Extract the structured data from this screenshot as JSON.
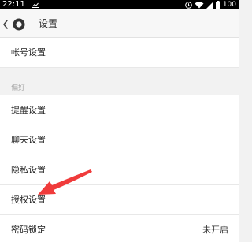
{
  "status_bar": {
    "time": "22:11",
    "battery": "100",
    "icons": [
      "notification-icon",
      "clock-icon",
      "wifi-icon",
      "signal-icon",
      "battery-icon"
    ]
  },
  "header": {
    "title": "设置",
    "back_icon": "chevron-left-icon",
    "app_icon": "app-logo-icon"
  },
  "settings": {
    "account": {
      "label": "帐号设置"
    },
    "section_preferences": "偏好",
    "items": [
      {
        "label": "提醒设置"
      },
      {
        "label": "聊天设置"
      },
      {
        "label": "隐私设置"
      },
      {
        "label": "授权设置"
      },
      {
        "label": "密码锁定",
        "value": "未开启"
      }
    ]
  },
  "colors": {
    "accent_arrow": "#f03b3b",
    "background": "#f2f2f2",
    "row_background": "#ffffff"
  }
}
